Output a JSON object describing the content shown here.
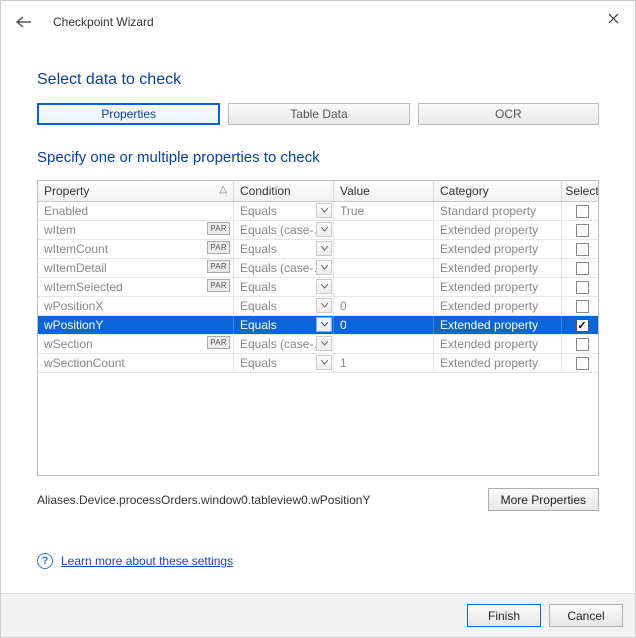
{
  "titlebar": {
    "title": "Checkpoint Wizard"
  },
  "section_title": "Select data to check",
  "tabs": {
    "properties": "Properties",
    "table_data": "Table Data",
    "ocr": "OCR"
  },
  "subheading": "Specify one or multiple properties to check",
  "columns": {
    "property": "Property",
    "condition": "Condition",
    "value": "Value",
    "category": "Category",
    "select": "Select"
  },
  "rows": [
    {
      "property": "Enabled",
      "par": false,
      "condition": "Equals",
      "value": "True",
      "category": "Standard property",
      "selected": false,
      "highlight": false
    },
    {
      "property": "wItem",
      "par": true,
      "condition": "Equals (case-…",
      "value": "",
      "category": "Extended property",
      "selected": false,
      "highlight": false
    },
    {
      "property": "wItemCount",
      "par": true,
      "condition": "Equals",
      "value": "",
      "category": "Extended property",
      "selected": false,
      "highlight": false
    },
    {
      "property": "wItemDetail",
      "par": true,
      "condition": "Equals (case-…",
      "value": "",
      "category": "Extended property",
      "selected": false,
      "highlight": false
    },
    {
      "property": "wItemSelected",
      "par": true,
      "condition": "Equals",
      "value": "",
      "category": "Extended property",
      "selected": false,
      "highlight": false
    },
    {
      "property": "wPositionX",
      "par": false,
      "condition": "Equals",
      "value": "0",
      "category": "Extended property",
      "selected": false,
      "highlight": false
    },
    {
      "property": "wPositionY",
      "par": false,
      "condition": "Equals",
      "value": "0",
      "category": "Extended property",
      "selected": true,
      "highlight": true
    },
    {
      "property": "wSection",
      "par": true,
      "condition": "Equals (case-…",
      "value": "",
      "category": "Extended property",
      "selected": false,
      "highlight": false
    },
    {
      "property": "wSectionCount",
      "par": false,
      "condition": "Equals",
      "value": "1",
      "category": "Extended property",
      "selected": false,
      "highlight": false
    }
  ],
  "par_label": "PAR",
  "path": "Aliases.Device.processOrders.window0.tableview0.wPositionY",
  "more_properties": "More Properties",
  "learn_link": "Learn more about these settings",
  "buttons": {
    "finish": "Finish",
    "cancel": "Cancel"
  }
}
